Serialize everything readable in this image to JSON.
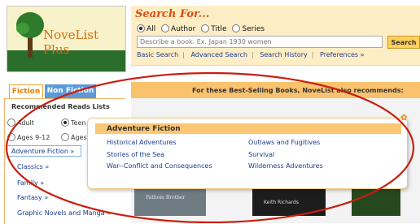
{
  "logo": {
    "title": "NoveList Plus"
  },
  "search": {
    "title": "Search For...",
    "options": [
      {
        "label": "All",
        "selected": true
      },
      {
        "label": "Author",
        "selected": false
      },
      {
        "label": "Title",
        "selected": false
      },
      {
        "label": "Series",
        "selected": false
      }
    ],
    "placeholder": "Describe a book. Ex. Japan 1930 women",
    "button_label": "Search",
    "links": [
      "Basic Search",
      "Advanced Search",
      "Search History",
      "Preferences »"
    ]
  },
  "tabs": {
    "fiction": "Fiction",
    "nonfiction": "Non Fiction"
  },
  "left": {
    "recommended_title": "Recommended Reads Lists",
    "audience": [
      {
        "label": "Adult",
        "selected": false
      },
      {
        "label": "Teen",
        "selected": true
      },
      {
        "label": "Ages 9-12",
        "selected": false
      },
      {
        "label": "Ages",
        "selected": false
      }
    ],
    "selected_list": "Adventure Fiction »",
    "lists": [
      "Classics »",
      "Family »",
      "Fantasy »",
      "Graphic Novels and Manga »"
    ]
  },
  "main": {
    "banner": "For these Best-Selling Books, NoveList also recommends:",
    "books": [
      {
        "text": "Fathom Brother"
      },
      {
        "text": "Keith Richards"
      }
    ]
  },
  "popup": {
    "title": "Adventure Fiction",
    "left_links": [
      "Historical Adventures",
      "Stories of the Sea",
      "War--Conflict and Consequences"
    ],
    "right_links": [
      "Outlaws and Fugitives",
      "Survival",
      "Wilderness Adventures"
    ]
  },
  "colors": {
    "accent": "#e04c0f",
    "link": "#1b3c8f",
    "annotation": "#c81e0e"
  }
}
